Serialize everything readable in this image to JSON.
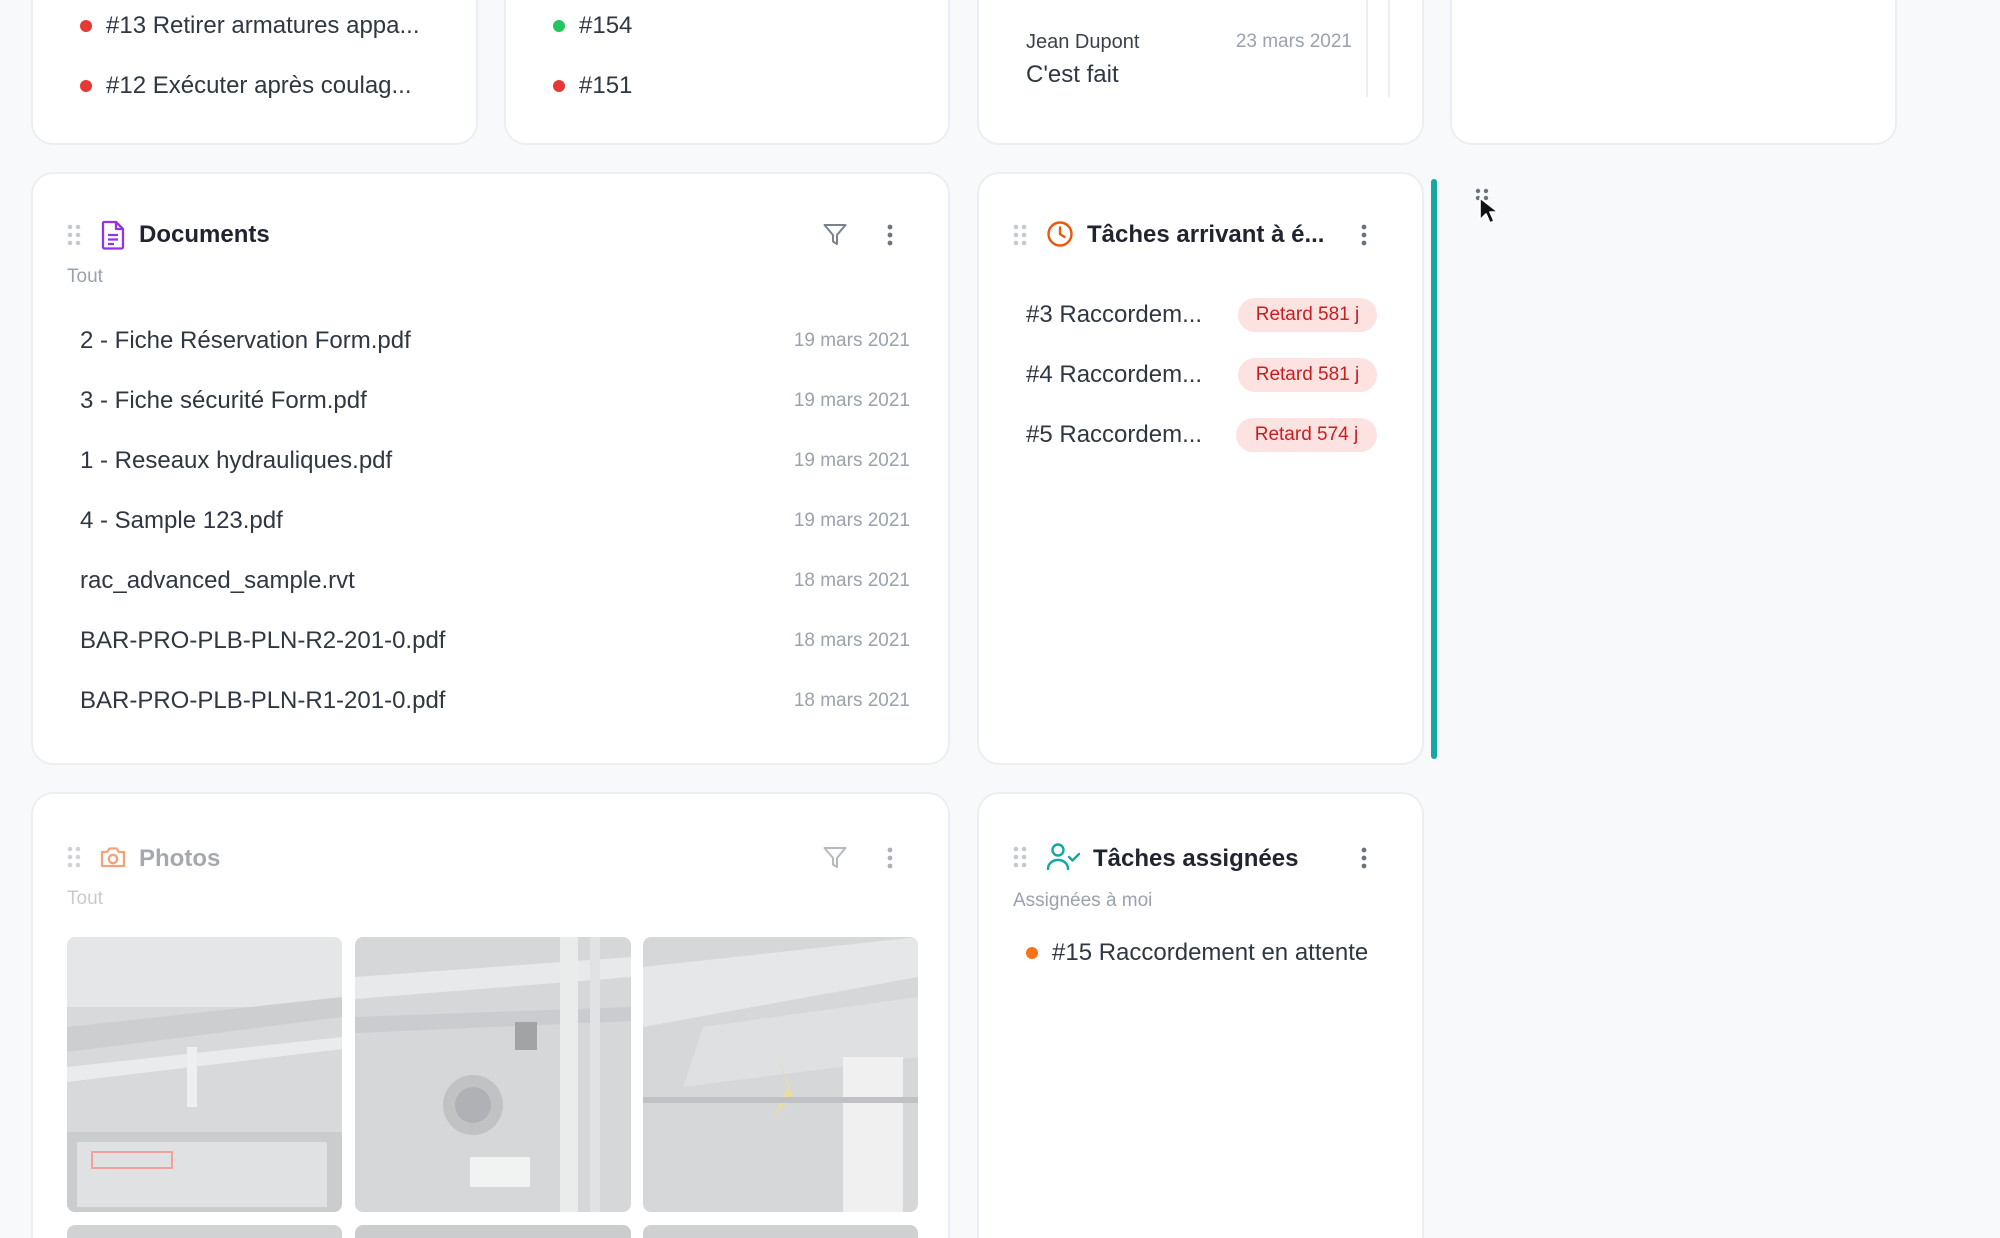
{
  "top_cards": {
    "tasks": [
      "#13 Retirer armatures appa...",
      "#12 Exécuter après coulag..."
    ],
    "ids": [
      "#154",
      "#151"
    ],
    "comment": {
      "author": "Jean Dupont",
      "date": "23 mars 2021",
      "text": "C'est fait"
    }
  },
  "documents": {
    "title": "Documents",
    "filter": "Tout",
    "items": [
      {
        "name": "2 - Fiche Réservation Form.pdf",
        "date": "19 mars 2021"
      },
      {
        "name": "3 - Fiche sécurité Form.pdf",
        "date": "19 mars 2021"
      },
      {
        "name": "1 - Reseaux hydrauliques.pdf",
        "date": "19 mars 2021"
      },
      {
        "name": "4 - Sample 123.pdf",
        "date": "19 mars 2021"
      },
      {
        "name": "rac_advanced_sample.rvt",
        "date": "18 mars 2021"
      },
      {
        "name": "BAR-PRO-PLB-PLN-R2-201-0.pdf",
        "date": "18 mars 2021"
      },
      {
        "name": "BAR-PRO-PLB-PLN-R1-201-0.pdf",
        "date": "18 mars 2021"
      }
    ]
  },
  "due_tasks": {
    "title": "Tâches arrivant à é...",
    "items": [
      {
        "name": "#3 Raccordem...",
        "badge": "Retard 581 j"
      },
      {
        "name": "#4 Raccordem...",
        "badge": "Retard 581 j"
      },
      {
        "name": "#5 Raccordem...",
        "badge": "Retard 574 j"
      }
    ]
  },
  "photos": {
    "title": "Photos",
    "filter": "Tout"
  },
  "assigned": {
    "title": "Tâches assignées",
    "filter": "Assignées à moi",
    "items": [
      "#15 Raccordement en attente"
    ]
  },
  "colors": {
    "red": "#e53935",
    "green": "#22c55e",
    "orange": "#f97316",
    "teal": "#14a8a0",
    "purple": "#9333ea"
  }
}
